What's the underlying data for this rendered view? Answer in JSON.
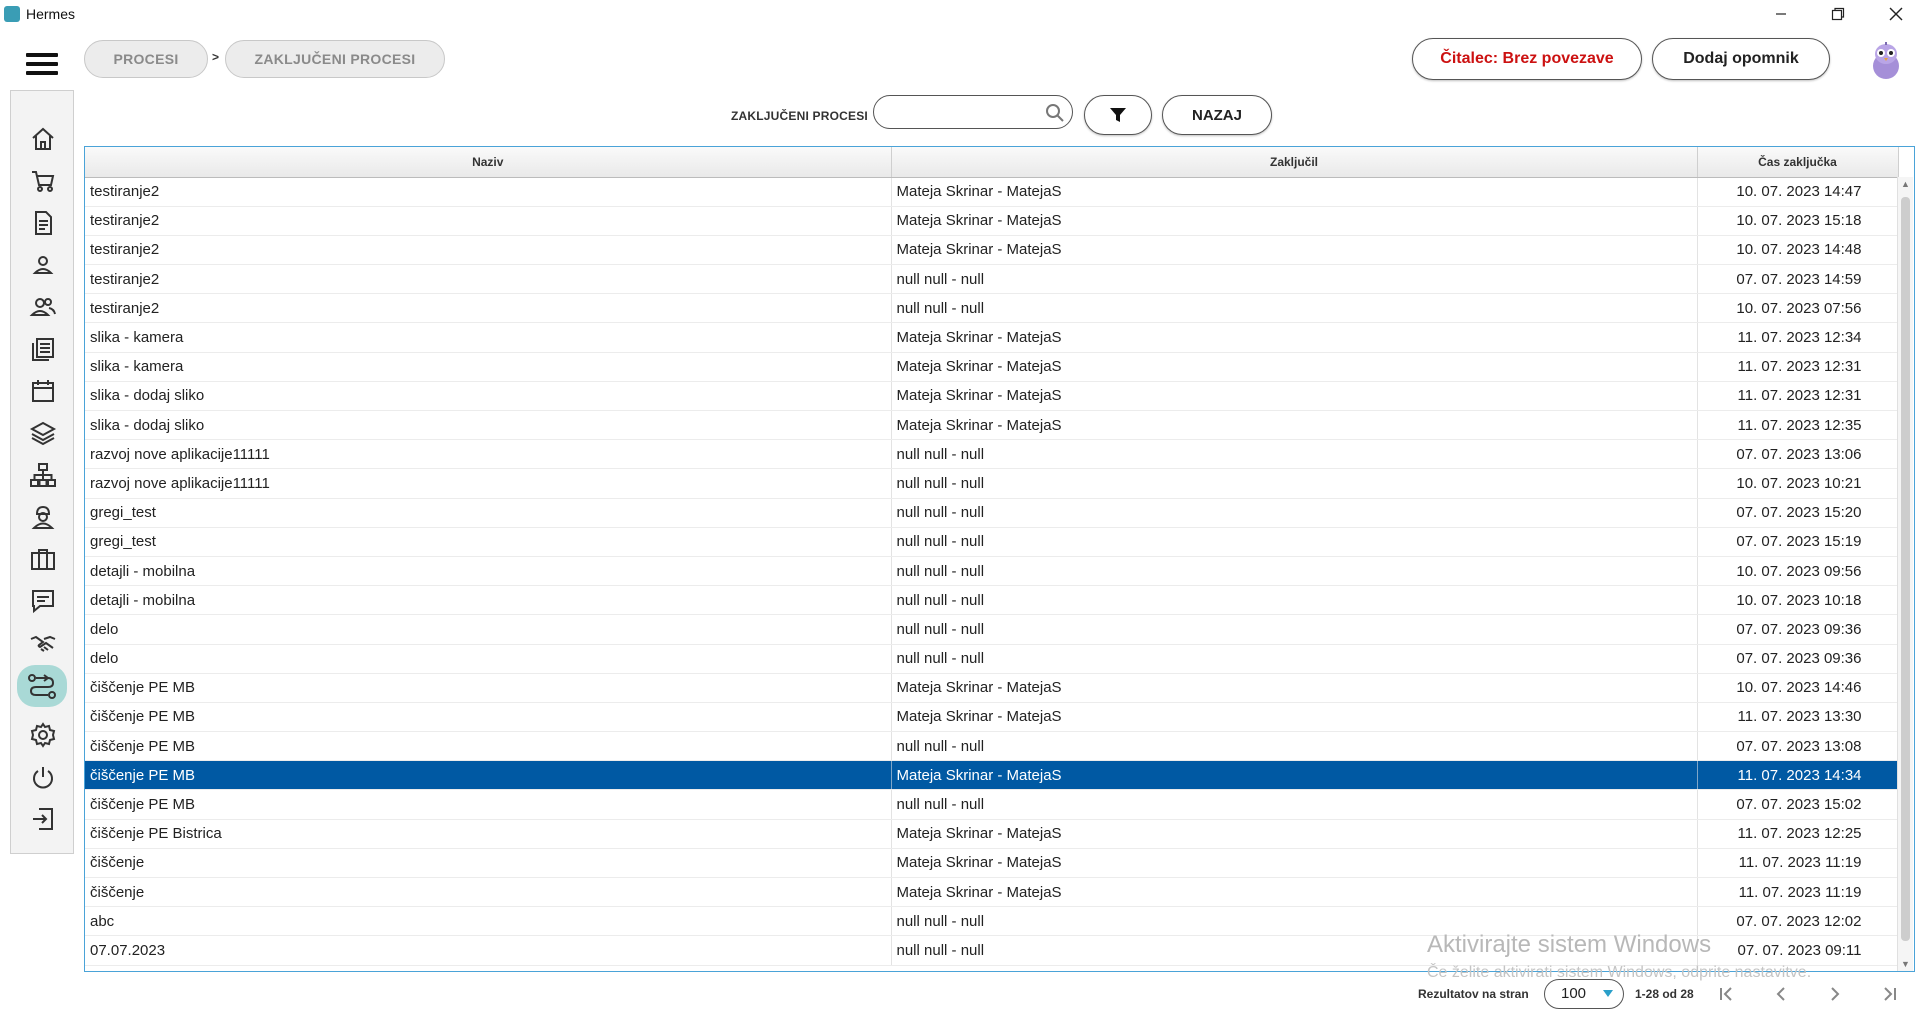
{
  "window": {
    "title": "Hermes",
    "controls": [
      "minimize-icon",
      "restore-icon",
      "close-icon"
    ]
  },
  "breadcrumb": {
    "items": [
      "PROCESI",
      "ZAKLJUČENI PROCESI"
    ],
    "separator": ">"
  },
  "header": {
    "reader_label": "Čitalec: Brez povezave",
    "reminder_label": "Dodaj opomnik"
  },
  "sidebar": {
    "items": [
      {
        "icon": "home-icon"
      },
      {
        "icon": "cart-icon"
      },
      {
        "icon": "document-icon"
      },
      {
        "icon": "user-icon"
      },
      {
        "icon": "users-icon"
      },
      {
        "icon": "list-icon"
      },
      {
        "icon": "calendar-icon"
      },
      {
        "icon": "layers-icon"
      },
      {
        "icon": "network-icon"
      },
      {
        "icon": "worker-icon"
      },
      {
        "icon": "briefcase-icon"
      },
      {
        "icon": "chat-icon"
      },
      {
        "icon": "handshake-icon"
      },
      {
        "icon": "process-icon",
        "active": true
      },
      {
        "icon": "gear-icon"
      },
      {
        "icon": "power-icon"
      },
      {
        "icon": "logout-icon"
      }
    ]
  },
  "search": {
    "label": "ZAKLJUČENI PROCESI",
    "value": "",
    "placeholder": "",
    "back_label": "NAZAJ"
  },
  "table": {
    "columns": [
      "Naziv",
      "Zaključil",
      "Čas zaključka"
    ],
    "rows": [
      [
        "testiranje2",
        "Mateja Skrinar - MatejaS",
        "10. 07. 2023 14:47"
      ],
      [
        "testiranje2",
        "Mateja Skrinar - MatejaS",
        "10. 07. 2023 15:18"
      ],
      [
        "testiranje2",
        "Mateja Skrinar - MatejaS",
        "10. 07. 2023 14:48"
      ],
      [
        "testiranje2",
        "null null - null",
        "07. 07. 2023 14:59"
      ],
      [
        "testiranje2",
        "null null - null",
        "10. 07. 2023 07:56"
      ],
      [
        "slika - kamera",
        "Mateja Skrinar - MatejaS",
        "11. 07. 2023 12:34"
      ],
      [
        "slika - kamera",
        "Mateja Skrinar - MatejaS",
        "11. 07. 2023 12:31"
      ],
      [
        "slika - dodaj sliko",
        "Mateja Skrinar - MatejaS",
        "11. 07. 2023 12:31"
      ],
      [
        "slika - dodaj sliko",
        "Mateja Skrinar - MatejaS",
        "11. 07. 2023 12:35"
      ],
      [
        "razvoj nove aplikacije11111",
        "null null - null",
        "07. 07. 2023 13:06"
      ],
      [
        "razvoj nove aplikacije11111",
        "null null - null",
        "10. 07. 2023 10:21"
      ],
      [
        "gregi_test",
        "null null - null",
        "07. 07. 2023 15:20"
      ],
      [
        "gregi_test",
        "null null - null",
        "07. 07. 2023 15:19"
      ],
      [
        "detajli - mobilna",
        "null null - null",
        "10. 07. 2023 09:56"
      ],
      [
        "detajli - mobilna",
        "null null - null",
        "10. 07. 2023 10:18"
      ],
      [
        "delo",
        "null null - null",
        "07. 07. 2023 09:36"
      ],
      [
        "delo",
        "null null - null",
        "07. 07. 2023 09:36"
      ],
      [
        "čiščenje PE MB",
        "Mateja Skrinar - MatejaS",
        "10. 07. 2023 14:46"
      ],
      [
        "čiščenje PE MB",
        "Mateja Skrinar - MatejaS",
        "11. 07. 2023 13:30"
      ],
      [
        "čiščenje PE MB",
        "null null - null",
        "07. 07. 2023 13:08"
      ],
      [
        "čiščenje PE MB",
        "Mateja Skrinar - MatejaS",
        "11. 07. 2023 14:34"
      ],
      [
        "čiščenje PE MB",
        "null null - null",
        "07. 07. 2023 15:02"
      ],
      [
        "čiščenje PE Bistrica",
        "Mateja Skrinar - MatejaS",
        "11. 07. 2023 12:25"
      ],
      [
        "čiščenje",
        "Mateja Skrinar - MatejaS",
        "11. 07. 2023 11:19"
      ],
      [
        "čiščenje",
        "Mateja Skrinar - MatejaS",
        "11. 07. 2023 11:19"
      ],
      [
        "abc",
        "null null - null",
        "07. 07. 2023 12:02"
      ],
      [
        "07.07.2023",
        "null null - null",
        "07. 07. 2023 09:11"
      ]
    ],
    "selected_row": 20
  },
  "watermark": {
    "line1": "Aktivirajte sistem Windows",
    "line2": "Če želite aktivirati sistem Windows, odprite nastavitve."
  },
  "pagination": {
    "label": "Rezultatov na stran",
    "page_size": "100",
    "range": "1-28 od 28"
  },
  "colors": {
    "selected_row": "#0059a3",
    "reader_text": "#cc1111",
    "active_nav": "#a9d9d6",
    "table_border": "#4aa3d8"
  }
}
